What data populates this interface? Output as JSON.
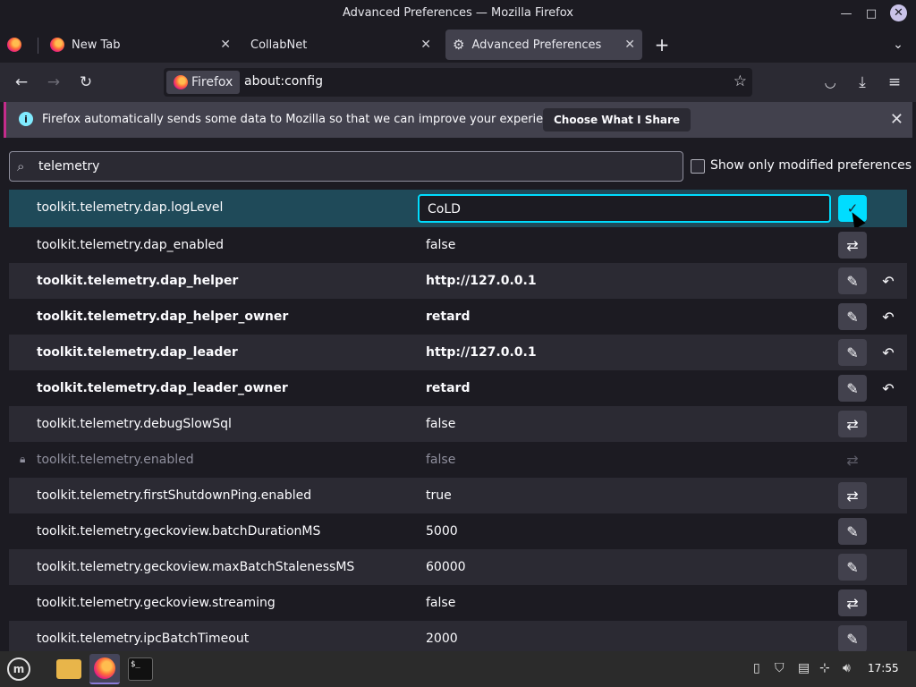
{
  "window": {
    "title": "Advanced Preferences — Mozilla Firefox"
  },
  "tabs": [
    {
      "label": "New Tab"
    },
    {
      "label": "CollabNet"
    },
    {
      "label": "Advanced Preferences"
    }
  ],
  "urlbar": {
    "identity_label": "Firefox",
    "url": "about:config"
  },
  "infobar": {
    "message": "Firefox automatically sends some data to Mozilla so that we can improve your experience.",
    "button_label": "Choose What I Share"
  },
  "search": {
    "value": "telemetry"
  },
  "filter": {
    "label": "Show only modified preferences"
  },
  "editing": {
    "value": "CoLD"
  },
  "prefs": [
    {
      "name": "toolkit.telemetry.dap.logLevel",
      "value": "CoLD",
      "state": "editing"
    },
    {
      "name": "toolkit.telemetry.dap_enabled",
      "value": "false",
      "action": "toggle"
    },
    {
      "name": "toolkit.telemetry.dap_helper",
      "value": "http://127.0.0.1",
      "action": "edit",
      "modified": true
    },
    {
      "name": "toolkit.telemetry.dap_helper_owner",
      "value": "retard",
      "action": "edit",
      "modified": true
    },
    {
      "name": "toolkit.telemetry.dap_leader",
      "value": "http://127.0.0.1",
      "action": "edit",
      "modified": true
    },
    {
      "name": "toolkit.telemetry.dap_leader_owner",
      "value": "retard",
      "action": "edit",
      "modified": true
    },
    {
      "name": "toolkit.telemetry.debugSlowSql",
      "value": "false",
      "action": "toggle"
    },
    {
      "name": "toolkit.telemetry.enabled",
      "value": "false",
      "action": "toggle",
      "locked": true
    },
    {
      "name": "toolkit.telemetry.firstShutdownPing.enabled",
      "value": "true",
      "action": "toggle"
    },
    {
      "name": "toolkit.telemetry.geckoview.batchDurationMS",
      "value": "5000",
      "action": "edit"
    },
    {
      "name": "toolkit.telemetry.geckoview.maxBatchStalenessMS",
      "value": "60000",
      "action": "edit"
    },
    {
      "name": "toolkit.telemetry.geckoview.streaming",
      "value": "false",
      "action": "toggle"
    },
    {
      "name": "toolkit.telemetry.ipcBatchTimeout",
      "value": "2000",
      "action": "edit"
    }
  ],
  "taskbar": {
    "clock": "17:55",
    "terminal_prompt": "$_"
  },
  "colors": {
    "accent": "#00ddff",
    "selected_row": "#1f4a59",
    "infobar_stripe": "#c42c8b"
  }
}
